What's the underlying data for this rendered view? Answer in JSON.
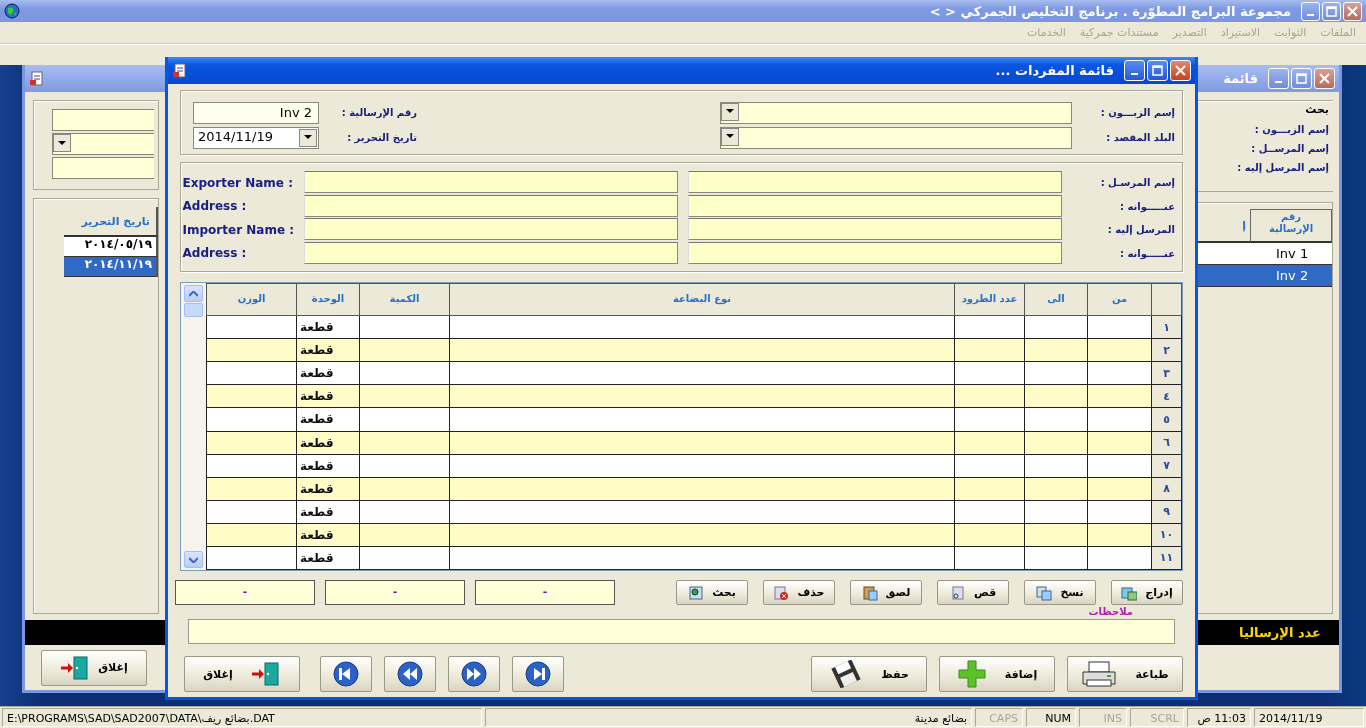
{
  "app": {
    "title": "مجموعة البرامج المطوّرة . برنامج التخليص الجمركي < >",
    "menu": [
      {
        "label": "الملفات",
        "disabled": true
      },
      {
        "label": "الثوابت",
        "disabled": true
      },
      {
        "label": "الاستيراد",
        "disabled": true
      },
      {
        "label": "التصدير",
        "disabled": true
      },
      {
        "label": "مستندات جمركية",
        "disabled": true
      },
      {
        "label": "الخدمات",
        "disabled": true
      }
    ]
  },
  "background_window": {
    "title": "قائمة",
    "search_label": "بحث",
    "search_labels": [
      "إسم الزبـــون :",
      "إسم المرســل :",
      "إسم المرسل إليه :"
    ],
    "right_table": {
      "columns": [
        "رقم الإرسالية",
        "إ"
      ],
      "rows": [
        {
          "text": "Inv 1",
          "selected": false
        },
        {
          "text": "Inv 2",
          "selected": true
        }
      ]
    },
    "left_table": {
      "columns": [
        "تاريخ التحرير"
      ],
      "rows": [
        {
          "text": "٢٠١٤/٠٥/١٩",
          "selected": false
        },
        {
          "text": "٢٠١٤/١١/١٩",
          "selected": true
        }
      ]
    },
    "count_label": "عدد الإرساليا",
    "close_button": "إغلاق"
  },
  "dialog": {
    "title": "قائمة المفردات ...",
    "customer_label": "إسم الزبـــون :",
    "destination_label": "البلد المقصد :",
    "shipment_label": "رقم الإرسالية :",
    "shipment_value": "Inv 2",
    "date_label": "تاريخ التحرير :",
    "date_value": "2014/11/19",
    "parties": [
      {
        "label": "إسم المرسـل :",
        "en_label": "Exporter Name :"
      },
      {
        "label": "عنـــــوانه :",
        "en_label": "Address :"
      },
      {
        "label": "المرسل إليه :",
        "en_label": "Importer Name :"
      },
      {
        "label": "عنـــــوانه :",
        "en_label": "Address :"
      }
    ],
    "grid": {
      "columns": [
        "من",
        "الى",
        "عدد الطرود",
        "نوع البضاعة",
        "الكمية",
        "الوحدة",
        "الوزن"
      ],
      "rows": [
        {
          "number": "١",
          "unit": "قطعة"
        },
        {
          "number": "٢",
          "unit": "قطعة"
        },
        {
          "number": "٣",
          "unit": "قطعة"
        },
        {
          "number": "٤",
          "unit": "قطعة"
        },
        {
          "number": "٥",
          "unit": "قطعة"
        },
        {
          "number": "٦",
          "unit": "قطعة"
        },
        {
          "number": "٧",
          "unit": "قطعة"
        },
        {
          "number": "٨",
          "unit": "قطعة"
        },
        {
          "number": "٩",
          "unit": "قطعة"
        },
        {
          "number": "١٠",
          "unit": "قطعة"
        },
        {
          "number": "١١",
          "unit": "قطعة"
        }
      ]
    },
    "tools": [
      {
        "label": "إدراج",
        "kind": "insert"
      },
      {
        "label": "نسخ",
        "kind": "copy"
      },
      {
        "label": "قص",
        "kind": "cut"
      },
      {
        "label": "لصق",
        "kind": "paste"
      },
      {
        "label": "حذف",
        "kind": "delete"
      },
      {
        "label": "بحث",
        "kind": "search"
      }
    ],
    "totals": [
      "-",
      "-",
      "-"
    ],
    "notes_label": "ملاحظات",
    "actions": [
      {
        "label": "طباعة",
        "kind": "print"
      },
      {
        "label": "إضافة",
        "kind": "add"
      },
      {
        "label": "حفظ",
        "kind": "save"
      }
    ],
    "nav": [
      {
        "kind": "last"
      },
      {
        "kind": "next"
      },
      {
        "kind": "previous"
      },
      {
        "kind": "first"
      }
    ],
    "close_button": "إغلاق"
  },
  "status_bar": [
    {
      "text": "2014/11/19",
      "disabled": false
    },
    {
      "text": "11:03 ص",
      "disabled": false
    },
    {
      "text": "SCRL",
      "disabled": true
    },
    {
      "text": "INS",
      "disabled": true
    },
    {
      "text": "NUM",
      "disabled": false
    },
    {
      "text": "CAPS",
      "disabled": true
    },
    {
      "text": "بضائع مدينة",
      "disabled": false
    },
    {
      "text": "E:\\PROGRAMS\\SAD\\SAD2007\\DATA\\بضائع ريف.DAT",
      "disabled": false
    }
  ]
}
